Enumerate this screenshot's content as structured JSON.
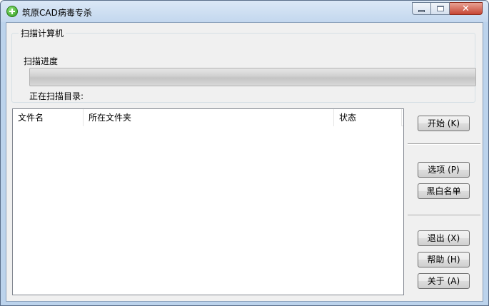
{
  "window": {
    "title": "筑原CAD病毒专杀"
  },
  "scan_group": {
    "legend": "扫描计算机",
    "progress_label": "扫描进度",
    "progress_fraction": 0,
    "current_dir_label": "正在扫描目录:"
  },
  "results_table": {
    "columns": [
      "文件名",
      "所在文件夹",
      "状态"
    ],
    "rows": []
  },
  "buttons": {
    "start": "开始 (K)",
    "options": "选项 (P)",
    "whitelist": "黑白名单",
    "exit": "退出 (X)",
    "help": "帮助 (H)",
    "about": "关于 (A)"
  },
  "icons": {
    "app": "green-plus-circle-icon",
    "minimize": "minimize-icon",
    "maximize": "maximize-icon",
    "close": "close-icon"
  },
  "colors": {
    "titlebar": "#c3d7ee",
    "close_button": "#c74634",
    "dialog_background": "#f0f0f0"
  }
}
